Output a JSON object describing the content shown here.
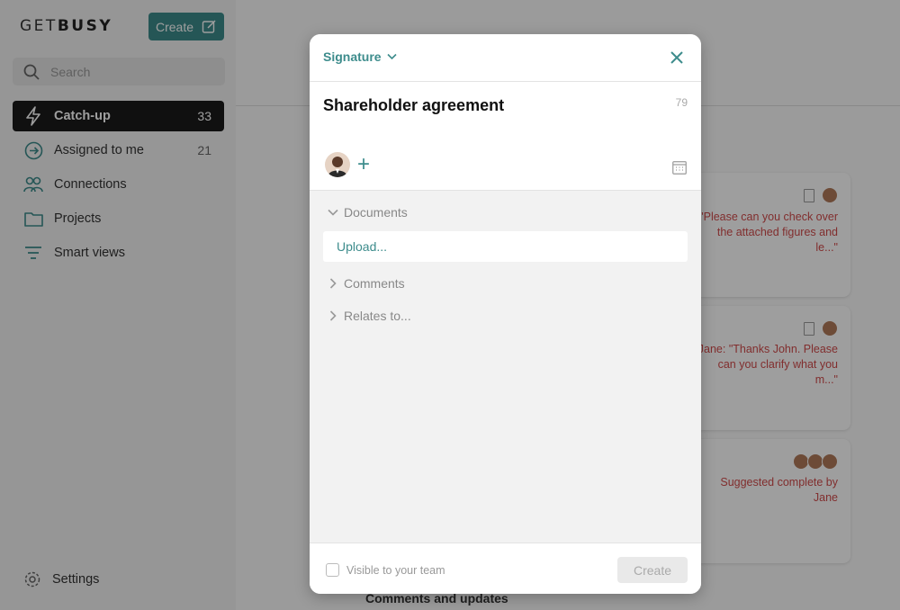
{
  "app": {
    "logo_light": "GET",
    "logo_bold": "BUSY",
    "create_label": "Create"
  },
  "search": {
    "placeholder": "Search"
  },
  "sidebar": {
    "items": [
      {
        "label": "Catch-up",
        "count": "33",
        "icon": "lightning-icon",
        "active": true
      },
      {
        "label": "Assigned to me",
        "count": "21",
        "icon": "arrow-circle-icon",
        "active": false
      },
      {
        "label": "Connections",
        "count": "",
        "icon": "people-icon",
        "active": false
      },
      {
        "label": "Projects",
        "count": "",
        "icon": "folder-icon",
        "active": false
      },
      {
        "label": "Smart views",
        "count": "",
        "icon": "filter-lines-icon",
        "active": false
      }
    ],
    "settings_label": "Settings"
  },
  "background": {
    "cards": [
      {
        "message": "\"Please can you check over the attached figures and le...\""
      },
      {
        "message": "Jane: \"Thanks John. Please can you clarify what you m...\""
      },
      {
        "message": "Suggested complete by Jane"
      }
    ],
    "bottom_heading": "Comments and updates"
  },
  "modal": {
    "type_label": "Signature",
    "title_value": "Shareholder agreement",
    "char_count": "79",
    "sections": {
      "documents": "Documents",
      "upload": "Upload...",
      "comments": "Comments",
      "relates": "Relates to..."
    },
    "visible_label": "Visible to your team",
    "create_label": "Create"
  },
  "colors": {
    "accent": "#3d8c8c",
    "active_nav_bg": "#1a1a1a",
    "card_message": "#d14b4b"
  }
}
